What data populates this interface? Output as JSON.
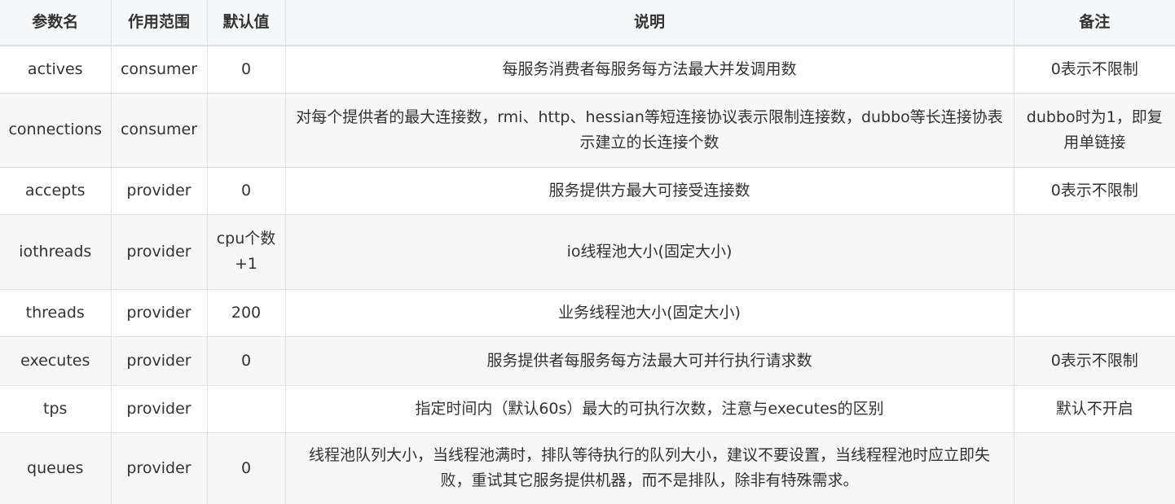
{
  "table": {
    "headers": [
      "参数名",
      "作用范围",
      "默认值",
      "说明",
      "备注"
    ],
    "rows": [
      {
        "name": "actives",
        "scope": "consumer",
        "default": "0",
        "desc": "每服务消费者每服务每方法最大并发调用数",
        "note": "0表示不限制"
      },
      {
        "name": "connections",
        "scope": "consumer",
        "default": "",
        "desc": "对每个提供者的最大连接数，rmi、http、hessian等短连接协议表示限制连接数，dubbo等长连接协表示建立的长连接个数",
        "note": "dubbo时为1，即复用单链接"
      },
      {
        "name": "accepts",
        "scope": "provider",
        "default": "0",
        "desc": "服务提供方最大可接受连接数",
        "note": "0表示不限制"
      },
      {
        "name": "iothreads",
        "scope": "provider",
        "default": "cpu个数+1",
        "desc": "io线程池大小(固定大小)",
        "note": ""
      },
      {
        "name": "threads",
        "scope": "provider",
        "default": "200",
        "desc": "业务线程池大小(固定大小)",
        "note": ""
      },
      {
        "name": "executes",
        "scope": "provider",
        "default": "0",
        "desc": "服务提供者每服务每方法最大可并行执行请求数",
        "note": "0表示不限制"
      },
      {
        "name": "tps",
        "scope": "provider",
        "default": "",
        "desc": "指定时间内（默认60s）最大的可执行次数，注意与executes的区别",
        "note": "默认不开启"
      },
      {
        "name": "queues",
        "scope": "provider",
        "default": "0",
        "desc": "线程池队列大小，当线程池满时，排队等待执行的队列大小，建议不要设置，当线程程池时应立即失败，重试其它服务提供机器，而不是排队，除非有特殊需求。",
        "note": ""
      }
    ]
  }
}
